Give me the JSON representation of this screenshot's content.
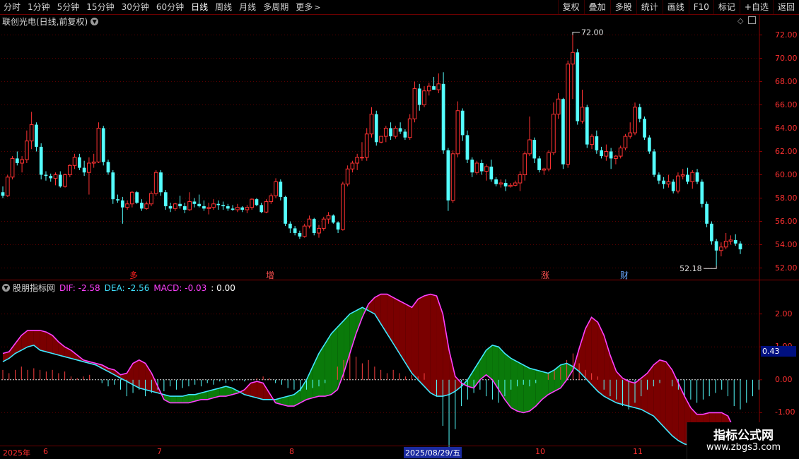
{
  "toolbar": {
    "tabs": [
      "分时",
      "1分钟",
      "5分钟",
      "15分钟",
      "30分钟",
      "60分钟",
      "日线",
      "周线",
      "月线",
      "多周期",
      "更多"
    ],
    "active_tab": "日线",
    "more_icon": "chevron-right-icon",
    "tools": [
      "复权",
      "叠加",
      "多股",
      "统计",
      "画线",
      "F10",
      "标记",
      "+自选",
      "返回"
    ]
  },
  "chart_title": "联创光电(日线,前复权)",
  "macd_legend": {
    "name": "股朋指标网",
    "dif": "DIF: -2.58",
    "dea": "DEA: -2.56",
    "macd": "MACD: -0.03",
    "zero": ": 0.00"
  },
  "badge": "0.43",
  "date_axis": {
    "year": "2025年",
    "months": [
      "6",
      "7",
      "8",
      "10",
      "11"
    ],
    "selected": "2025/08/29/五"
  },
  "events": [
    {
      "text": "多",
      "color": "#ff2020"
    },
    {
      "text": "增",
      "color": "#ff5050"
    },
    {
      "text": "涨",
      "color": "#ff5050"
    },
    {
      "text": "财",
      "color": "#6aa8ff"
    }
  ],
  "watermark": {
    "title": "指标公式网",
    "url": "www.zbgs3.com"
  },
  "chart_data": {
    "type": "candlestick",
    "price_axis": {
      "min": 51,
      "max": 73,
      "ticks": [
        52,
        54,
        56,
        58,
        60,
        62,
        64,
        66,
        68,
        70,
        72
      ]
    },
    "annotations": {
      "high": "72.00",
      "low": "52.18"
    },
    "ohlc": [
      [
        58.5,
        59.0,
        58.0,
        58.2
      ],
      [
        58.2,
        60.0,
        58.1,
        59.8
      ],
      [
        59.8,
        61.6,
        59.6,
        61.4
      ],
      [
        61.4,
        62.0,
        60.8,
        61.0
      ],
      [
        61.0,
        61.6,
        60.2,
        61.3
      ],
      [
        61.3,
        63.8,
        61.0,
        62.9
      ],
      [
        62.9,
        65.4,
        62.2,
        64.3
      ],
      [
        64.3,
        64.5,
        62.0,
        62.4
      ],
      [
        62.4,
        62.7,
        59.6,
        60.0
      ],
      [
        60.0,
        60.3,
        59.5,
        59.9
      ],
      [
        59.9,
        60.1,
        59.4,
        59.7
      ],
      [
        59.7,
        60.2,
        59.1,
        60.0
      ],
      [
        60.0,
        60.3,
        58.9,
        59.0
      ],
      [
        59.0,
        60.1,
        58.9,
        60.0
      ],
      [
        60.0,
        60.9,
        59.8,
        60.8
      ],
      [
        60.8,
        61.8,
        60.5,
        61.5
      ],
      [
        61.5,
        61.8,
        60.4,
        60.6
      ],
      [
        60.6,
        61.2,
        59.9,
        60.2
      ],
      [
        60.2,
        61.5,
        58.3,
        61.0
      ],
      [
        61.0,
        61.8,
        60.6,
        61.1
      ],
      [
        61.1,
        64.5,
        61.0,
        64.0
      ],
      [
        64.0,
        64.2,
        60.8,
        61.1
      ],
      [
        61.1,
        61.3,
        60.0,
        60.2
      ],
      [
        60.2,
        60.4,
        57.5,
        57.9
      ],
      [
        57.9,
        58.3,
        57.6,
        57.8
      ],
      [
        57.8,
        58.1,
        55.8,
        57.2
      ],
      [
        57.2,
        57.8,
        57.0,
        57.5
      ],
      [
        57.5,
        58.6,
        57.2,
        58.5
      ],
      [
        58.5,
        58.6,
        57.5,
        57.6
      ],
      [
        57.6,
        57.9,
        56.9,
        57.1
      ],
      [
        57.1,
        57.7,
        57.0,
        57.5
      ],
      [
        57.5,
        58.6,
        57.3,
        58.4
      ],
      [
        58.4,
        60.4,
        58.2,
        60.2
      ],
      [
        60.2,
        60.4,
        58.2,
        58.5
      ],
      [
        58.5,
        58.7,
        57.0,
        57.3
      ],
      [
        57.3,
        57.6,
        56.8,
        57.1
      ],
      [
        57.1,
        57.6,
        56.9,
        57.5
      ],
      [
        57.5,
        58.2,
        57.1,
        57.3
      ],
      [
        57.3,
        57.6,
        56.7,
        57.0
      ],
      [
        57.0,
        58.5,
        56.9,
        57.7
      ],
      [
        57.7,
        58.0,
        57.2,
        57.5
      ],
      [
        57.5,
        58.3,
        57.2,
        57.3
      ],
      [
        57.3,
        57.8,
        56.9,
        57.1
      ],
      [
        57.1,
        57.6,
        56.6,
        57.2
      ],
      [
        57.2,
        57.9,
        57.0,
        57.5
      ],
      [
        57.5,
        57.8,
        57.0,
        57.4
      ],
      [
        57.4,
        57.7,
        57.0,
        57.3
      ],
      [
        57.3,
        57.5,
        56.9,
        57.1
      ],
      [
        57.1,
        57.4,
        56.9,
        57.0
      ],
      [
        57.0,
        57.5,
        56.8,
        57.2
      ],
      [
        57.2,
        57.3,
        56.8,
        57.0
      ],
      [
        57.0,
        57.4,
        56.7,
        57.2
      ],
      [
        57.2,
        58.0,
        57.0,
        57.9
      ],
      [
        57.9,
        58.0,
        57.3,
        57.4
      ],
      [
        57.4,
        57.6,
        56.7,
        56.8
      ],
      [
        56.8,
        57.9,
        56.7,
        57.7
      ],
      [
        57.7,
        58.4,
        57.5,
        58.2
      ],
      [
        58.2,
        59.7,
        58.0,
        59.4
      ],
      [
        59.4,
        59.6,
        57.8,
        58.1
      ],
      [
        58.1,
        58.2,
        55.6,
        55.8
      ],
      [
        55.8,
        56.0,
        55.0,
        55.4
      ],
      [
        55.4,
        55.6,
        54.8,
        55.0
      ],
      [
        55.0,
        55.2,
        54.5,
        54.7
      ],
      [
        54.7,
        55.8,
        54.6,
        55.6
      ],
      [
        55.6,
        56.5,
        55.4,
        56.2
      ],
      [
        56.2,
        56.3,
        54.8,
        55.0
      ],
      [
        55.0,
        55.7,
        54.6,
        55.4
      ],
      [
        55.4,
        56.4,
        55.2,
        56.2
      ],
      [
        56.2,
        56.8,
        55.8,
        56.5
      ],
      [
        56.5,
        56.6,
        55.8,
        55.9
      ],
      [
        55.9,
        56.0,
        55.0,
        55.3
      ],
      [
        55.3,
        59.4,
        55.2,
        59.2
      ],
      [
        59.2,
        60.8,
        59.0,
        60.5
      ],
      [
        60.5,
        61.2,
        60.2,
        61.0
      ],
      [
        61.0,
        61.8,
        60.4,
        61.5
      ],
      [
        61.5,
        62.8,
        61.2,
        61.5
      ],
      [
        61.5,
        64.0,
        61.2,
        63.5
      ],
      [
        63.5,
        65.8,
        63.2,
        65.2
      ],
      [
        65.2,
        65.5,
        62.5,
        62.8
      ],
      [
        62.8,
        63.0,
        62.7,
        63.3
      ],
      [
        63.3,
        64.2,
        62.8,
        64.0
      ],
      [
        64.0,
        64.5,
        63.0,
        63.3
      ],
      [
        63.3,
        64.2,
        63.1,
        64.0
      ],
      [
        64.0,
        64.5,
        63.5,
        63.7
      ],
      [
        63.7,
        63.9,
        63.0,
        63.2
      ],
      [
        63.2,
        65.2,
        63.0,
        64.8
      ],
      [
        64.8,
        68.0,
        64.5,
        67.4
      ],
      [
        67.4,
        67.8,
        65.5,
        66.0
      ],
      [
        66.0,
        67.6,
        65.8,
        67.2
      ],
      [
        67.2,
        67.9,
        66.8,
        67.6
      ],
      [
        67.6,
        68.4,
        67.4,
        67.3
      ],
      [
        67.3,
        68.7,
        67.0,
        67.8
      ],
      [
        67.8,
        68.8,
        61.8,
        62.1
      ],
      [
        62.1,
        62.3,
        56.9,
        57.8
      ],
      [
        57.8,
        62.1,
        57.6,
        61.8
      ],
      [
        61.8,
        66.3,
        61.5,
        65.5
      ],
      [
        65.5,
        65.7,
        62.9,
        63.4
      ],
      [
        63.4,
        63.8,
        61.0,
        61.3
      ],
      [
        61.3,
        61.5,
        59.8,
        60.2
      ],
      [
        60.2,
        61.2,
        60.0,
        61.0
      ],
      [
        61.0,
        61.3,
        60.0,
        60.3
      ],
      [
        60.3,
        60.9,
        59.5,
        60.7
      ],
      [
        60.7,
        61.3,
        59.4,
        59.6
      ],
      [
        59.6,
        59.8,
        59.0,
        59.2
      ],
      [
        59.2,
        59.6,
        58.9,
        59.3
      ],
      [
        59.3,
        59.6,
        58.6,
        59.0
      ],
      [
        59.0,
        59.3,
        58.9,
        59.1
      ],
      [
        59.1,
        59.5,
        59.0,
        59.3
      ],
      [
        59.3,
        60.3,
        58.6,
        60.0
      ],
      [
        60.0,
        62.0,
        59.5,
        61.8
      ],
      [
        61.8,
        65.0,
        61.6,
        63.0
      ],
      [
        63.0,
        63.2,
        61.0,
        61.4
      ],
      [
        61.4,
        61.6,
        60.2,
        60.4
      ],
      [
        60.4,
        60.6,
        60.0,
        60.5
      ],
      [
        60.5,
        62.1,
        60.3,
        61.9
      ],
      [
        61.9,
        66.2,
        61.7,
        65.2
      ],
      [
        65.2,
        67.0,
        64.8,
        66.5
      ],
      [
        66.5,
        66.6,
        60.5,
        60.9
      ],
      [
        60.9,
        69.8,
        60.6,
        69.5
      ],
      [
        69.5,
        72.0,
        66.5,
        70.5
      ],
      [
        70.5,
        70.8,
        64.3,
        64.6
      ],
      [
        64.6,
        67.3,
        64.4,
        65.8
      ],
      [
        65.8,
        66.0,
        62.3,
        62.6
      ],
      [
        62.6,
        63.5,
        62.2,
        63.3
      ],
      [
        63.3,
        63.8,
        61.8,
        62.1
      ],
      [
        62.1,
        62.4,
        61.4,
        61.6
      ],
      [
        61.6,
        62.6,
        61.2,
        62.0
      ],
      [
        62.0,
        62.3,
        60.5,
        61.4
      ],
      [
        61.4,
        61.7,
        60.9,
        61.6
      ],
      [
        61.6,
        62.5,
        61.4,
        62.3
      ],
      [
        62.3,
        63.5,
        62.1,
        63.3
      ],
      [
        63.3,
        64.5,
        63.1,
        63.6
      ],
      [
        63.6,
        66.2,
        63.4,
        65.8
      ],
      [
        65.8,
        66.1,
        64.5,
        64.8
      ],
      [
        64.8,
        65.0,
        63.0,
        63.2
      ],
      [
        63.2,
        63.4,
        61.8,
        62.0
      ],
      [
        62.0,
        62.2,
        59.8,
        60.0
      ],
      [
        60.0,
        60.2,
        59.2,
        59.5
      ],
      [
        59.5,
        59.8,
        58.8,
        59.2
      ],
      [
        59.2,
        60.0,
        58.9,
        59.4
      ],
      [
        59.4,
        59.6,
        58.4,
        58.6
      ],
      [
        58.6,
        60.2,
        58.4,
        59.9
      ],
      [
        59.9,
        60.5,
        59.6,
        60.0
      ],
      [
        60.0,
        60.6,
        59.2,
        59.4
      ],
      [
        59.4,
        60.4,
        58.8,
        60.2
      ],
      [
        60.2,
        60.5,
        59.2,
        59.4
      ],
      [
        59.4,
        59.6,
        57.2,
        57.5
      ],
      [
        57.5,
        57.7,
        55.5,
        55.8
      ],
      [
        55.8,
        56.0,
        54.0,
        54.3
      ],
      [
        54.3,
        54.5,
        52.2,
        53.5
      ],
      [
        53.5,
        54.2,
        53.0,
        53.8
      ],
      [
        53.8,
        55.0,
        53.6,
        54.3
      ],
      [
        54.3,
        54.8,
        54.0,
        54.4
      ],
      [
        54.4,
        54.9,
        53.9,
        54.1
      ],
      [
        54.1,
        54.3,
        53.2,
        53.6
      ]
    ],
    "macd": {
      "axis": {
        "min": -2.0,
        "max": 3.0,
        "ticks": [
          -1.0,
          0.0,
          1.0,
          2.0
        ]
      },
      "dif": [
        0.8,
        0.85,
        1.1,
        1.35,
        1.5,
        1.5,
        1.5,
        1.45,
        1.35,
        1.15,
        1.0,
        0.9,
        0.75,
        0.6,
        0.55,
        0.5,
        0.45,
        0.35,
        0.3,
        0.15,
        0.2,
        0.5,
        0.6,
        0.5,
        0.2,
        -0.2,
        -0.6,
        -0.7,
        -0.7,
        -0.7,
        -0.7,
        -0.65,
        -0.6,
        -0.6,
        -0.55,
        -0.5,
        -0.5,
        -0.45,
        -0.4,
        -0.3,
        -0.1,
        -0.05,
        -0.1,
        -0.4,
        -0.7,
        -0.75,
        -0.8,
        -0.8,
        -0.7,
        -0.6,
        -0.55,
        -0.5,
        -0.5,
        -0.45,
        -0.3,
        0.2,
        0.8,
        1.4,
        1.9,
        2.3,
        2.5,
        2.6,
        2.6,
        2.5,
        2.4,
        2.3,
        2.2,
        2.45,
        2.55,
        2.6,
        2.55,
        2.0,
        0.9,
        0.1,
        -0.1,
        -0.2,
        -0.25,
        0.0,
        0.15,
        0.0,
        -0.3,
        -0.6,
        -0.85,
        -0.95,
        -1.0,
        -0.95,
        -0.8,
        -0.6,
        -0.45,
        -0.35,
        -0.25,
        0.0,
        0.3,
        0.95,
        1.55,
        1.9,
        1.75,
        1.35,
        0.75,
        0.25,
        0.05,
        -0.05,
        -0.1,
        0.05,
        0.2,
        0.45,
        0.6,
        0.55,
        0.3,
        -0.1,
        -0.5,
        -0.85,
        -1.05,
        -1.05,
        -1.0,
        -1.0,
        -1.0,
        -1.1,
        -1.5,
        -1.9
      ],
      "dea": [
        0.55,
        0.65,
        0.8,
        0.9,
        1.0,
        1.05,
        0.9,
        0.85,
        0.8,
        0.75,
        0.7,
        0.65,
        0.6,
        0.55,
        0.5,
        0.45,
        0.35,
        0.25,
        0.15,
        0.05,
        -0.05,
        -0.15,
        -0.25,
        -0.3,
        -0.35,
        -0.4,
        -0.45,
        -0.5,
        -0.5,
        -0.5,
        -0.45,
        -0.45,
        -0.4,
        -0.35,
        -0.3,
        -0.25,
        -0.2,
        -0.25,
        -0.35,
        -0.45,
        -0.5,
        -0.55,
        -0.6,
        -0.6,
        -0.6,
        -0.55,
        -0.5,
        -0.45,
        -0.3,
        0.0,
        0.4,
        0.8,
        1.1,
        1.4,
        1.6,
        1.8,
        2.0,
        2.1,
        2.2,
        2.1,
        2.0,
        1.7,
        1.4,
        1.1,
        0.8,
        0.5,
        0.2,
        0.0,
        -0.2,
        -0.4,
        -0.5,
        -0.5,
        -0.45,
        -0.35,
        -0.2,
        0.0,
        0.3,
        0.6,
        0.9,
        1.05,
        1.0,
        0.8,
        0.65,
        0.55,
        0.45,
        0.35,
        0.3,
        0.25,
        0.2,
        0.3,
        0.45,
        0.5,
        0.4,
        0.25,
        0.05,
        -0.15,
        -0.35,
        -0.5,
        -0.6,
        -0.7,
        -0.75,
        -0.8,
        -0.85,
        -0.9,
        -1.0,
        -1.1,
        -1.3,
        -1.5,
        -1.7,
        -1.85,
        -1.95,
        -2.0,
        -2.05,
        -2.1,
        -2.15,
        -2.2,
        -2.25,
        -2.3,
        -2.35,
        -2.4
      ],
      "hist": [
        0.3,
        0.2,
        0.3,
        0.4,
        0.3,
        0.35,
        0.3,
        0.25,
        0.3,
        0.2,
        0.25,
        0.1,
        0.05,
        0.1,
        0.15,
        0.0,
        -0.1,
        -0.2,
        -0.15,
        -0.3,
        -0.5,
        -0.4,
        -0.3,
        -0.5,
        -0.4,
        -0.3,
        -0.35,
        -0.2,
        -0.3,
        -0.25,
        -0.2,
        -0.15,
        -0.2,
        -0.1,
        -0.15,
        -0.05,
        -0.1,
        -0.05,
        0.0,
        -0.05,
        0.0,
        0.05,
        0.1,
        0.05,
        -0.1,
        -0.15,
        -0.25,
        -0.3,
        -0.35,
        -0.3,
        -0.25,
        -0.2,
        -0.1,
        0.0,
        0.4,
        0.6,
        0.8,
        0.7,
        0.5,
        0.6,
        0.4,
        0.3,
        0.2,
        0.3,
        0.2,
        0.1,
        0.15,
        0.1,
        0.2,
        0.0,
        -0.5,
        -1.4,
        -2.1,
        -1.5,
        -0.8,
        -0.6,
        -0.4,
        -0.3,
        -0.5,
        -0.6,
        -0.7,
        -0.5,
        -0.3,
        -0.2,
        -0.15,
        -0.2,
        -0.1,
        0.0,
        0.2,
        0.3,
        0.4,
        0.6,
        0.8,
        0.5,
        0.3,
        0.2,
        0.1,
        -0.3,
        -0.5,
        -0.6,
        -0.8,
        -0.9,
        -0.7,
        -0.5,
        -0.3,
        -0.2,
        -0.1,
        0.0,
        -0.2,
        -0.3,
        -0.5,
        -0.6,
        -0.7,
        -0.6,
        -0.5,
        -0.4,
        -0.3,
        -0.5,
        -0.8,
        -0.9,
        -0.7,
        -0.5,
        -0.3
      ]
    }
  }
}
